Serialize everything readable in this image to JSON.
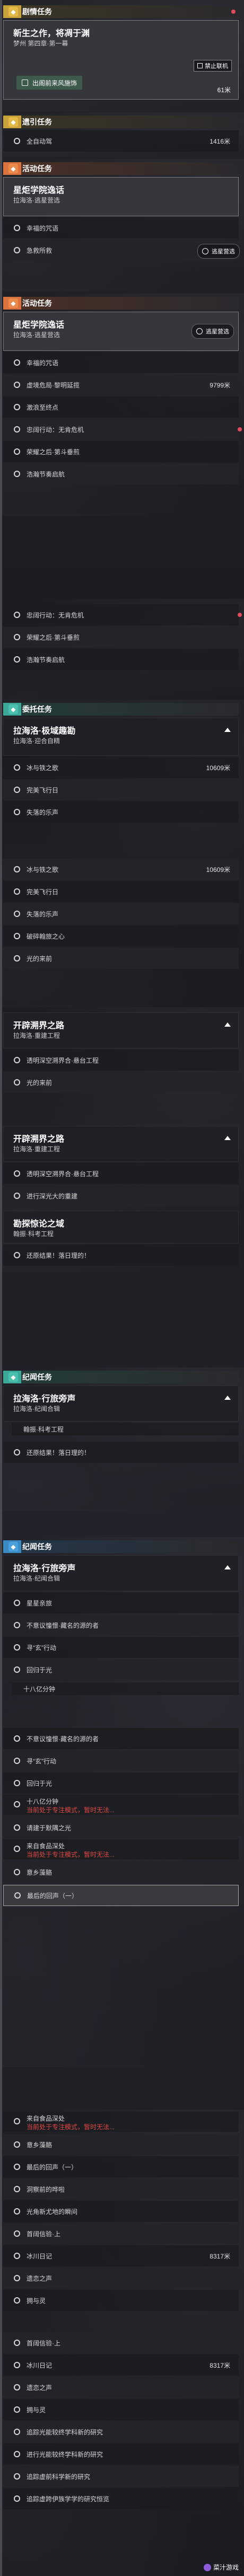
{
  "headers": {
    "cover": "剧情任务",
    "escort": "遗引任务",
    "activity": "活动任务",
    "explore": "委托任务",
    "collection": "纪闻任务"
  },
  "cover_task": {
    "title": "新生之作，将凋于渊",
    "subtitle": "梦州 第四章·第一幕",
    "action_label": "出阁前来风施饰",
    "distance": "61米",
    "badge": "禁止联机"
  },
  "escort_row": {
    "label": "全自动驾",
    "distance": "1416米"
  },
  "activity_task": {
    "title": "星炬学院逸话",
    "subtitle": "拉海洛·逃星营选",
    "badge": "逃星营选"
  },
  "activity_rows": [
    "幸福的咒语",
    "急救所救",
    "虚境危局·黎明延揽",
    "激浪至终点",
    "忠阔行动：无肯危机",
    "荣耀之后·第斗垂煎",
    "浩瀚节奏启航"
  ],
  "activity_distance": "9799米",
  "explore_task": {
    "title": "拉海洛·极域趣勘",
    "subtitle": "拉海洛·迎合自精"
  },
  "explore_rows": [
    "冰与铁之歌",
    "完美飞行日",
    "失落的乐声",
    "冰与铁之歌",
    "完美飞行日",
    "失落的乐声",
    "破碎翰旅之心",
    "光的来前"
  ],
  "explore_distance": "10609米",
  "frontier_task": {
    "title": "开辟溯界之路",
    "subtitle": "拉海洛·重建工程"
  },
  "frontier_rows": [
    "透明深空溯界合·悬台工程",
    "光的来前",
    "透明深空溯界合·悬台工程",
    "进行深光大的重建"
  ],
  "mystery_task": {
    "title": "勘探惊论之域",
    "subtitle": "翰振·科考工程"
  },
  "mystery_rows": [
    "还原结果！落日理的！"
  ],
  "chronicle_task": {
    "title": "拉海洛·行旅旁声",
    "subtitle": "拉海洛·纪闻合辑"
  },
  "chronicle_rows": [
    "星星亲旅",
    "不意议憧憬·藏名的源的者",
    "寻“玄”行动",
    "回归于光",
    "十八亿分钟"
  ],
  "chronicle_rows_2": [
    "不意议憧憬·藏名的源的者",
    "寻“玄”行动",
    "回归于光",
    "十八亿分钟",
    "请建于默隅之光",
    "来自食品深处",
    "意乡藻骼",
    "最后的回声（一）"
  ],
  "warn_text": "当前处于专注模式，暂时无法...",
  "final_rows": [
    "来自食品深处",
    "意乡藻骼",
    "最后的回声（一）",
    "洞察前的哗啦",
    "光角新尤地的瞬间",
    "首阔信验·上",
    "冰川日记",
    "遗恋之声",
    "拥与灵"
  ],
  "final_rows_2": [
    "首阔信验·上",
    "冰川日记",
    "遗恋之声",
    "拥与灵",
    "追踪光能较终学科新的研究",
    "进行光能较终学科新的研究",
    "追踪虚前科学新的研究",
    "追踪虚跨伊族学学的研究恒览"
  ],
  "final_distance": "8317米",
  "watermark": "菜汁游戏"
}
